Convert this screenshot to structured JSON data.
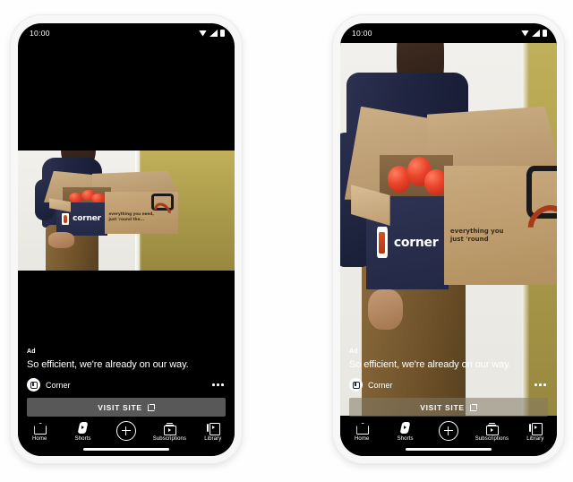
{
  "page": {
    "background_color": "#fefefe",
    "device_count": 2
  },
  "status_bar": {
    "time": "10:00",
    "icons": [
      "wifi-icon",
      "signal-icon",
      "battery-icon"
    ]
  },
  "video": {
    "brand_logo_text": "corner",
    "box_tagline_line1": "everything you need,",
    "box_tagline_line2": "just 'round the...",
    "box_tagline_fill_line1": "everything you",
    "box_tagline_fill_line2": "just 'round"
  },
  "ad": {
    "badge": "Ad",
    "headline": "So efficient, we're already on our way.",
    "brand": "Corner",
    "cta_label": "VISIT SITE",
    "cta_icon": "external-link-icon",
    "menu_icon": "more-options-icon",
    "avatar_icon": "corner-avatar-icon"
  },
  "nav": {
    "items": [
      {
        "label": "Home",
        "icon": "home-icon"
      },
      {
        "label": "Shorts",
        "icon": "shorts-icon"
      },
      {
        "label": "",
        "icon": "create-plus-icon"
      },
      {
        "label": "Subscriptions",
        "icon": "subscriptions-icon"
      },
      {
        "label": "Library",
        "icon": "library-icon"
      }
    ]
  },
  "phones": {
    "left": {
      "video_mode_label": "letterboxed-fit"
    },
    "right": {
      "video_mode_label": "full-bleed-fill"
    }
  },
  "colors": {
    "screen_background": "#000000",
    "text_primary": "#ffffff",
    "cta_background": "#606060",
    "brand_orange": "#d9531e",
    "box_kraft": "#c9aa7e",
    "panel_navy": "#2e3353",
    "wall_olive": "#a8994a"
  }
}
